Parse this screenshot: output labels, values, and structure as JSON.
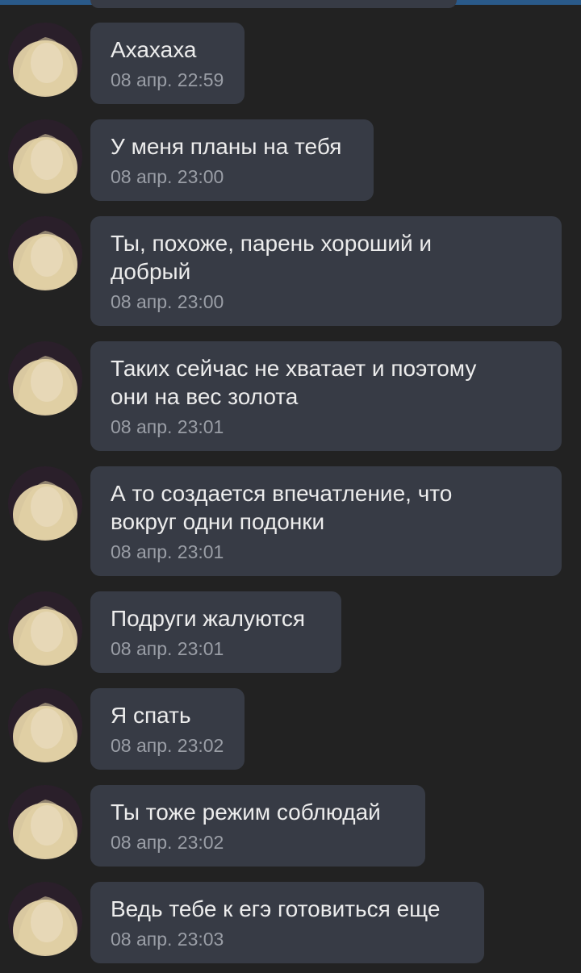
{
  "colors": {
    "background": "#222222",
    "bubble": "#373b45",
    "text": "#ececec",
    "timestamp": "#9a9ea6",
    "accent": "#2a5a8a"
  },
  "avatar": {
    "icon": "user-avatar-photo"
  },
  "messages": [
    {
      "text": "Ахахаха",
      "time": "08 апр. 22:59"
    },
    {
      "text": "У меня планы на тебя",
      "time": "08 апр. 23:00"
    },
    {
      "text": "Ты, похоже, парень хороший и\nдобрый",
      "time": "08 апр. 23:00"
    },
    {
      "text": "Таких сейчас не хватает и поэтому\nони на вес золота",
      "time": "08 апр. 23:01"
    },
    {
      "text": "А то создается впечатление, что\nвокруг одни подонки",
      "time": "08 апр. 23:01"
    },
    {
      "text": "Подруги жалуются",
      "time": "08 апр. 23:01"
    },
    {
      "text": "Я спать",
      "time": "08 апр. 23:02"
    },
    {
      "text": "Ты тоже режим соблюдай",
      "time": "08 апр. 23:02"
    },
    {
      "text": "Ведь тебе к егэ готовиться еще",
      "time": "08 апр. 23:03"
    }
  ]
}
